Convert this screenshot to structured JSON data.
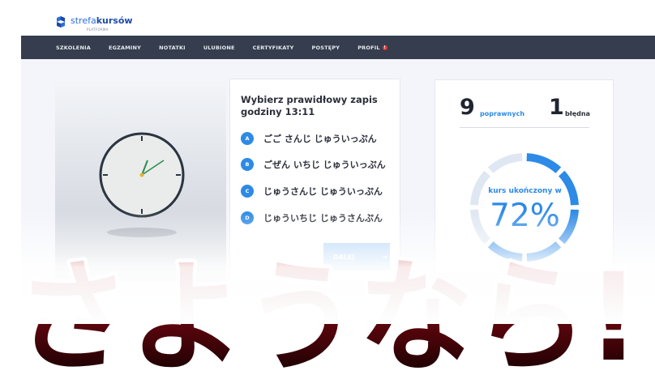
{
  "header": {
    "logo_left": "strefa",
    "logo_right": "kursów",
    "logo_sub": "PLATFORMA"
  },
  "nav": {
    "items": [
      "SZKOLENIA",
      "EGZAMINY",
      "NOTATKI",
      "ULUBIONE",
      "CERTYFIKATY",
      "POSTĘPY",
      "PROFIL"
    ],
    "profile_badge": "!"
  },
  "quiz": {
    "question": "Wybierz prawidłowy zapis godziny 13:11",
    "answers": [
      {
        "letter": "A",
        "text": "ごご さんじ じゅういっぷん"
      },
      {
        "letter": "B",
        "text": "ごぜん いちじ じゅういっぷん"
      },
      {
        "letter": "C",
        "text": "じゅうさんじ じゅういっぷん"
      },
      {
        "letter": "D",
        "text": "じゅういちじ じゅうさんぷん"
      }
    ],
    "next_label": "DALEJ",
    "next_arrow": "→"
  },
  "stats": {
    "correct_count": "9",
    "correct_label": "poprawnych",
    "wrong_count": "1",
    "wrong_label": "błędna",
    "progress_label": "kurs ukończony w",
    "progress_value": "72%",
    "progress_fraction": 0.72
  },
  "banner": {
    "text": "さようなら!"
  },
  "colors": {
    "accent": "#2d8ae6",
    "nav_bg": "#353d4e",
    "banner_red": "#c4101c"
  }
}
